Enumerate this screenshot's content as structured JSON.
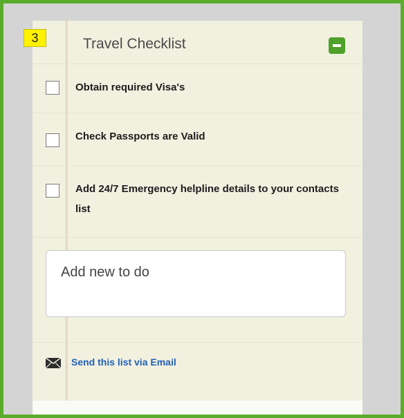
{
  "checklist": {
    "step_number": "3",
    "title": "Travel Checklist",
    "items": [
      {
        "label": "Obtain required Visa's",
        "checked": false
      },
      {
        "label": "Check Passports are Valid",
        "checked": false
      },
      {
        "label": "Add 24/7 Emergency helpline details to your contacts list",
        "checked": false
      }
    ],
    "add_input": {
      "placeholder": "Add new to do"
    },
    "email_link": "Send this list via Email",
    "colors": {
      "frame_border": "#5aac2c",
      "panel_background": "#f2f1e0",
      "badge_background": "#fff200",
      "collapse_button": "#4fa12a",
      "link": "#1f5fb8"
    },
    "icons": {
      "collapse": "minus-icon",
      "email": "envelope-icon"
    }
  }
}
